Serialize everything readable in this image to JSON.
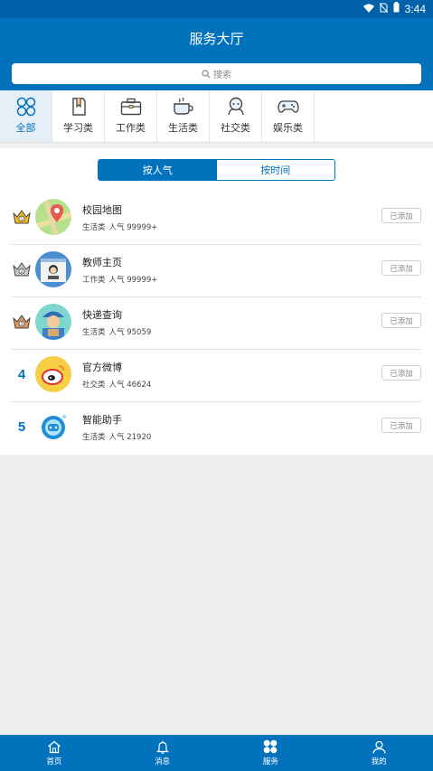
{
  "status_bar": {
    "time": "3:44"
  },
  "header": {
    "title": "服务大厅"
  },
  "search": {
    "placeholder": "搜索"
  },
  "categories": [
    {
      "label": "全部",
      "icon": "clover-grid-icon",
      "active": true
    },
    {
      "label": "学习类",
      "icon": "bookmark-book-icon",
      "active": false
    },
    {
      "label": "工作类",
      "icon": "briefcase-icon",
      "active": false
    },
    {
      "label": "生活类",
      "icon": "coffee-cup-icon",
      "active": false
    },
    {
      "label": "社交类",
      "icon": "people-chat-icon",
      "active": false
    },
    {
      "label": "娱乐类",
      "icon": "gamepad-icon",
      "active": false
    }
  ],
  "sort": {
    "popular": "按人气",
    "time": "按时间",
    "active": "popular"
  },
  "apps": [
    {
      "rank": "1",
      "rank_type": "crown-gold",
      "name": "校园地图",
      "category": "生活类",
      "popularity": "人气 99999+",
      "button": "已添加",
      "icon": "map-pin-icon"
    },
    {
      "rank": "2",
      "rank_type": "crown-silver",
      "name": "教师主页",
      "category": "工作类",
      "popularity": "人气 99999+",
      "button": "已添加",
      "icon": "teacher-profile-icon"
    },
    {
      "rank": "3",
      "rank_type": "crown-bronze",
      "name": "快递查询",
      "category": "生活类",
      "popularity": "人气 95059",
      "button": "已添加",
      "icon": "courier-icon"
    },
    {
      "rank": "4",
      "rank_type": "number",
      "name": "官方微博",
      "category": "社交类",
      "popularity": "人气 46624",
      "button": "已添加",
      "icon": "weibo-icon"
    },
    {
      "rank": "5",
      "rank_type": "number",
      "name": "智能助手",
      "category": "生活类",
      "popularity": "人气 21920",
      "button": "已添加",
      "icon": "robot-assistant-icon"
    }
  ],
  "tabbar": [
    {
      "label": "首页",
      "icon": "home-icon"
    },
    {
      "label": "消息",
      "icon": "bell-icon"
    },
    {
      "label": "服务",
      "icon": "clover-grid-icon"
    },
    {
      "label": "我的",
      "icon": "person-icon"
    }
  ],
  "colors": {
    "brand": "#0372bd",
    "status_bar": "#0161a8",
    "crown_gold": "#f1b824",
    "crown_silver": "#c9c9c9",
    "crown_bronze": "#e0975c"
  }
}
